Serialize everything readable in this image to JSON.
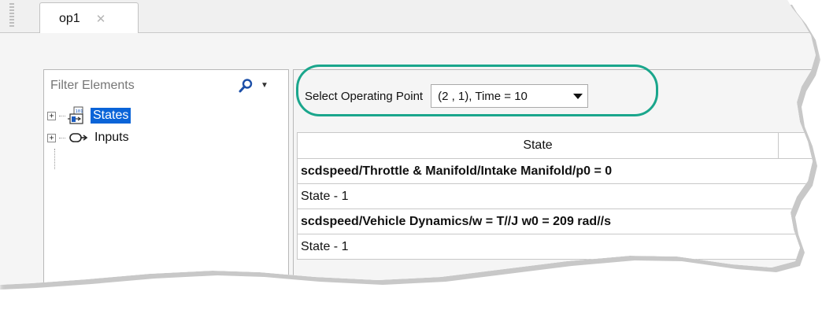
{
  "tab": {
    "label": "op1",
    "close_glyph": "✕"
  },
  "filter": {
    "placeholder": "Filter Elements"
  },
  "tree": [
    {
      "label": "States",
      "icon": "states-icon",
      "selected": true
    },
    {
      "label": "Inputs",
      "icon": "inputs-icon",
      "selected": false
    }
  ],
  "operating_point": {
    "label": "Select Operating Point",
    "selected": "(2 , 1), Time = 10"
  },
  "grid": {
    "header": "State",
    "rows": [
      {
        "text": "scdspeed/Throttle & Manifold/Intake Manifold/p0 = 0",
        "bold": true
      },
      {
        "text": "State - 1",
        "bold": false
      },
      {
        "text": "scdspeed/Vehicle Dynamics/w = T//J w0 = 209 rad//s",
        "bold": true
      },
      {
        "text": "State - 1",
        "bold": false
      }
    ]
  },
  "colors": {
    "selection": "#0a64d8",
    "highlight": "#1aa68c"
  }
}
